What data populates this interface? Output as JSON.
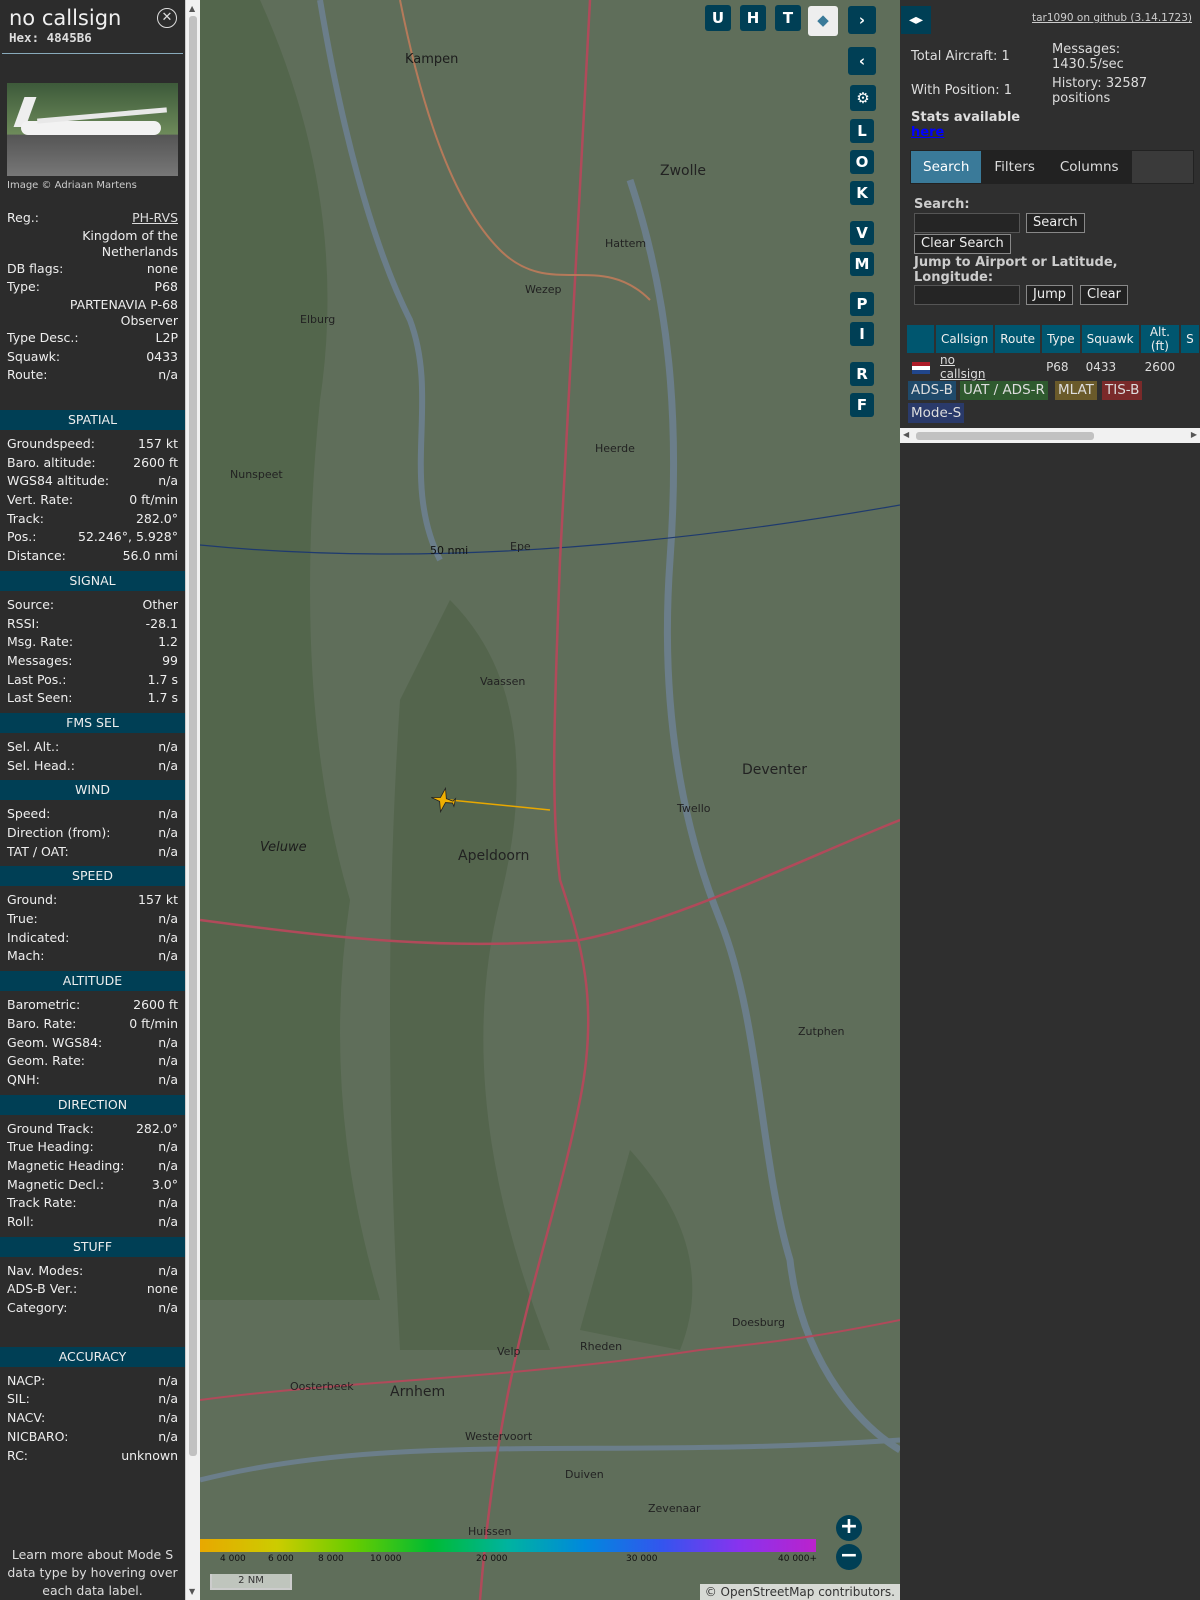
{
  "sidebar": {
    "callsign": "no callsign",
    "hex": "Hex: 4845B6",
    "photo_credit": "Image © Adriaan Martens",
    "details": [
      {
        "label": "Reg.:",
        "value": "PH-RVS"
      },
      {
        "label": "",
        "value": "Kingdom of the Netherlands"
      },
      {
        "label": "DB flags:",
        "value": "none"
      },
      {
        "label": "Type:",
        "value": "P68"
      },
      {
        "label": "",
        "value": "PARTENAVIA P-68 Observer"
      },
      {
        "label": "Type Desc.:",
        "value": "L2P"
      },
      {
        "label": "Squawk:",
        "value": "0433"
      },
      {
        "label": "Route:",
        "value": "n/a"
      }
    ],
    "sections": [
      {
        "title": "SPATIAL",
        "rows": [
          [
            "Groundspeed:",
            "157 kt"
          ],
          [
            "Baro. altitude:",
            "2600 ft"
          ],
          [
            "WGS84 altitude:",
            "n/a"
          ],
          [
            "Vert. Rate:",
            "0 ft/min"
          ],
          [
            "Track:",
            "282.0°"
          ],
          [
            "Pos.:",
            "52.246°, 5.928°"
          ],
          [
            "Distance:",
            "56.0 nmi"
          ]
        ]
      },
      {
        "title": "SIGNAL",
        "rows": [
          [
            "Source:",
            "Other"
          ],
          [
            "RSSI:",
            "-28.1"
          ],
          [
            "Msg. Rate:",
            "1.2"
          ],
          [
            "Messages:",
            "99"
          ],
          [
            "Last Pos.:",
            "1.7 s"
          ],
          [
            "Last Seen:",
            "1.7 s"
          ]
        ]
      },
      {
        "title": "FMS SEL",
        "rows": [
          [
            "Sel. Alt.:",
            "n/a"
          ],
          [
            "Sel. Head.:",
            "n/a"
          ]
        ]
      },
      {
        "title": "WIND",
        "rows": [
          [
            "Speed:",
            "n/a"
          ],
          [
            "Direction (from):",
            "n/a"
          ],
          [
            "TAT / OAT:",
            "n/a"
          ]
        ]
      },
      {
        "title": "SPEED",
        "rows": [
          [
            "Ground:",
            "157 kt"
          ],
          [
            "True:",
            "n/a"
          ],
          [
            "Indicated:",
            "n/a"
          ],
          [
            "Mach:",
            "n/a"
          ]
        ]
      },
      {
        "title": "ALTITUDE",
        "rows": [
          [
            "Barometric:",
            "2600 ft"
          ],
          [
            "Baro. Rate:",
            "0 ft/min"
          ],
          [
            "Geom. WGS84:",
            "n/a"
          ],
          [
            "Geom. Rate:",
            "n/a"
          ],
          [
            "QNH:",
            "n/a"
          ]
        ]
      },
      {
        "title": "DIRECTION",
        "rows": [
          [
            "Ground Track:",
            "282.0°"
          ],
          [
            "True Heading:",
            "n/a"
          ],
          [
            "Magnetic Heading:",
            "n/a"
          ],
          [
            "Magnetic Decl.:",
            "3.0°"
          ],
          [
            "Track Rate:",
            "n/a"
          ],
          [
            "Roll:",
            "n/a"
          ]
        ]
      },
      {
        "title": "STUFF",
        "rows": [
          [
            "Nav. Modes:",
            "n/a"
          ],
          [
            "ADS-B Ver.:",
            "none"
          ],
          [
            "Category:",
            "n/a"
          ]
        ]
      },
      {
        "title": "ACCURACY",
        "rows": [
          [
            "NACP:",
            "n/a"
          ],
          [
            "SIL:",
            "n/a"
          ],
          [
            "NACV:",
            "n/a"
          ],
          [
            "NICBARO:",
            "n/a"
          ],
          [
            "RC:",
            "unknown"
          ]
        ]
      }
    ],
    "learn_more": "Learn more about Mode S data type by hovering over each data label."
  },
  "map": {
    "top_buttons": [
      "U",
      "H",
      "T"
    ],
    "side_buttons": [
      "L",
      "O",
      "K",
      "V",
      "M",
      "P",
      "I",
      "R",
      "F"
    ],
    "range_label": "50 nmi",
    "scale": "2 NM",
    "attribution": "© OpenStreetMap contributors.",
    "alt_ticks": [
      "4 000",
      "6 000",
      "8 000",
      "10 000",
      "20 000",
      "30 000",
      "40 000+"
    ],
    "places": [
      {
        "n": "Kampen",
        "c": "city"
      },
      {
        "n": "Zwolle",
        "c": "big"
      },
      {
        "n": "Hattem",
        "c": ""
      },
      {
        "n": "Wezep",
        "c": ""
      },
      {
        "n": "Elburg",
        "c": ""
      },
      {
        "n": "Heerde",
        "c": ""
      },
      {
        "n": "Nunspeet",
        "c": ""
      },
      {
        "n": "Epe",
        "c": ""
      },
      {
        "n": "Vaassen",
        "c": ""
      },
      {
        "n": "Apeldoorn",
        "c": "big"
      },
      {
        "n": "Twello",
        "c": ""
      },
      {
        "n": "Deventer",
        "c": "big"
      },
      {
        "n": "Zutphen",
        "c": ""
      },
      {
        "n": "Veluwe",
        "c": "city"
      },
      {
        "n": "Doesburg",
        "c": ""
      },
      {
        "n": "Rheden",
        "c": ""
      },
      {
        "n": "Velp",
        "c": ""
      },
      {
        "n": "Arnhem",
        "c": "big"
      },
      {
        "n": "Oosterbeek",
        "c": ""
      },
      {
        "n": "Westervoort",
        "c": ""
      },
      {
        "n": "Duiven",
        "c": ""
      },
      {
        "n": "Huissen",
        "c": ""
      },
      {
        "n": "Zevenaar",
        "c": ""
      }
    ]
  },
  "panel": {
    "github": "tar1090 on github (3.14.1723)",
    "total_aircraft": "Total Aircraft: 1",
    "with_position": "With Position: 1",
    "messages": "Messages: 1430.5/sec",
    "history": "History: 32587 positions",
    "stats": "Stats available",
    "stats_link": "here",
    "tabs": [
      "Search",
      "Filters",
      "Columns"
    ],
    "search_label": "Search:",
    "search_btn": "Search",
    "clear_search_btn": "Clear Search",
    "jump_label": "Jump to Airport or Latitude, Longitude:",
    "jump_btn": "Jump",
    "clear_btn": "Clear",
    "columns": [
      "Callsign",
      "Route",
      "Type",
      "Squawk",
      "Alt. (ft)",
      "S"
    ],
    "rows": [
      {
        "callsign": "no callsign",
        "route": "",
        "type": "P68",
        "squawk": "0433",
        "alt": "2600"
      }
    ],
    "badges": [
      {
        "label": "ADS-B",
        "bg": "#1f4a6a",
        "fg": "#ddd"
      },
      {
        "label": "UAT / ADS-R",
        "bg": "#2f5a2f",
        "fg": "#ddd"
      },
      {
        "label": "MLAT",
        "bg": "#6a5a2a",
        "fg": "#ddd"
      },
      {
        "label": "TIS-B",
        "bg": "#7a2a2a",
        "fg": "#ddd"
      },
      {
        "label": "Mode-S",
        "bg": "#2a3a6a",
        "fg": "#ddd"
      }
    ]
  }
}
